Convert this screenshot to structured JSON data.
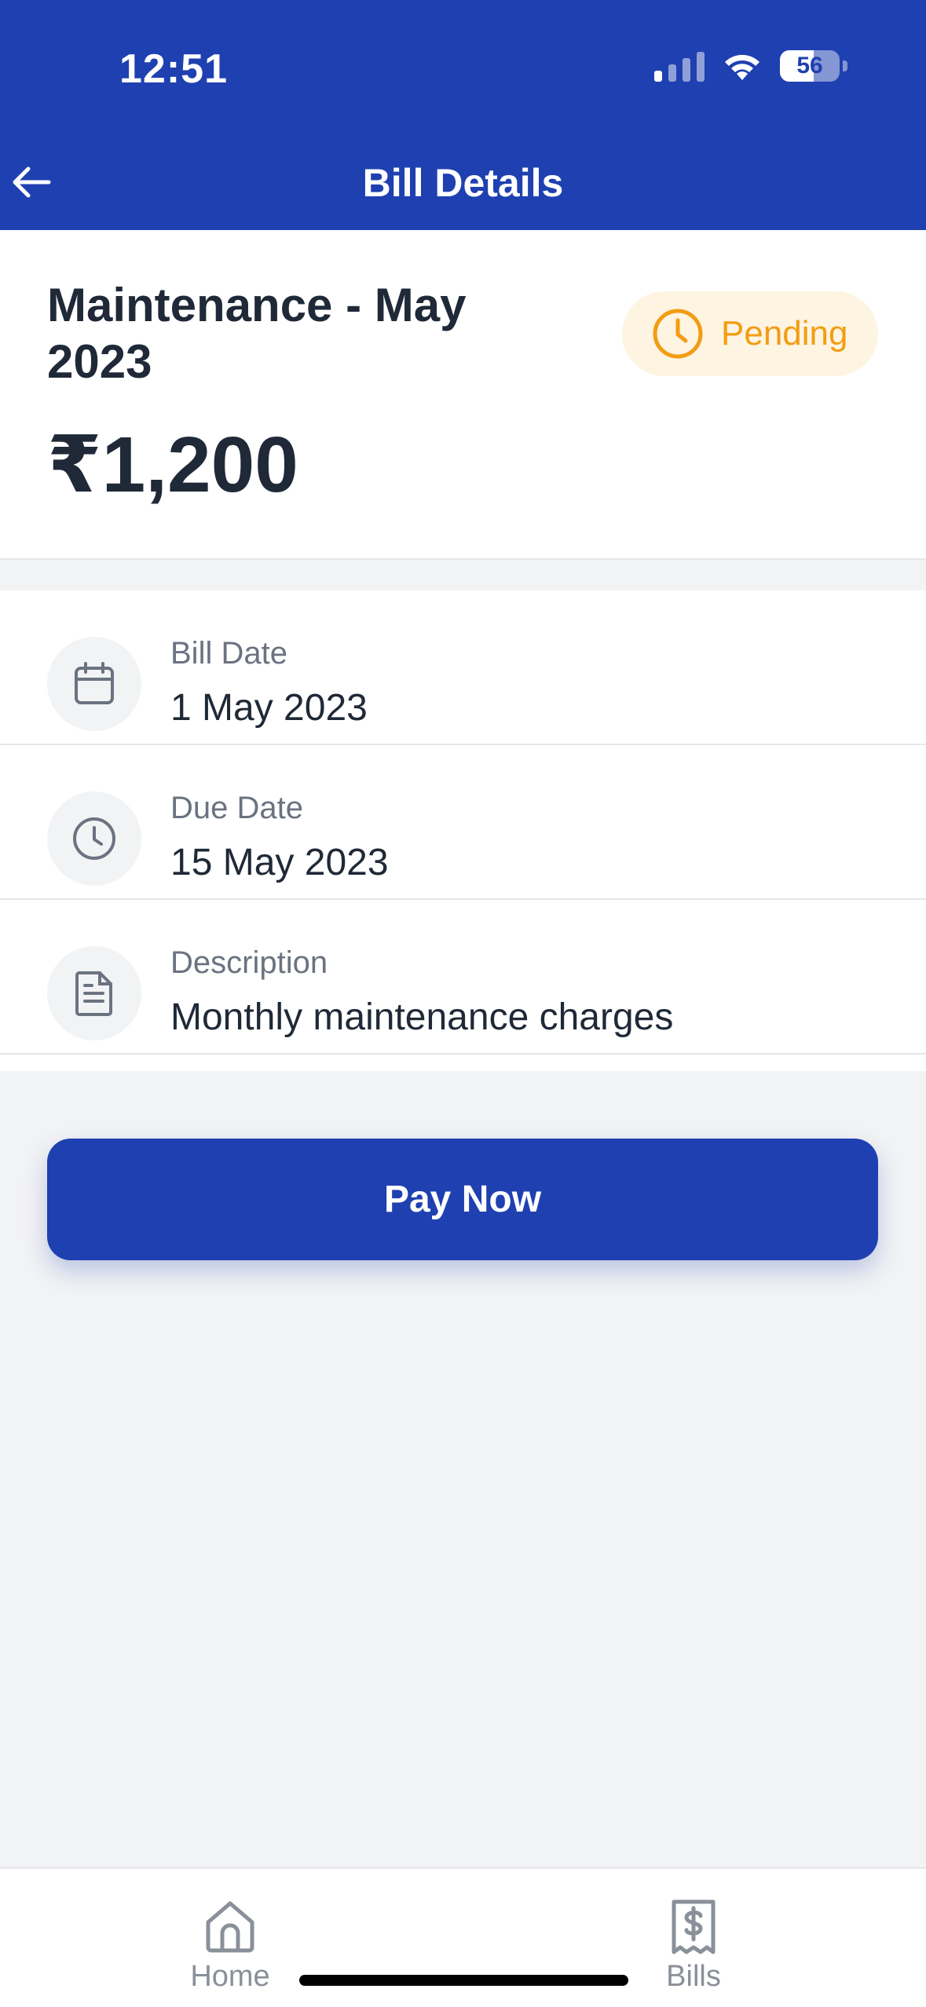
{
  "status_bar": {
    "time": "12:51",
    "battery": "56"
  },
  "header": {
    "title": "Bill Details",
    "back_icon": "arrow-left-icon",
    "background_color": "#1f40b0"
  },
  "bill": {
    "title": "Maintenance - May 2023",
    "amount": "₹1,200",
    "status": "Pending",
    "status_color": "#f39c12"
  },
  "details": [
    {
      "icon": "calendar-icon",
      "label": "Bill Date",
      "value": "1 May 2023"
    },
    {
      "icon": "clock-icon",
      "label": "Due Date",
      "value": "15 May 2023"
    },
    {
      "icon": "document-icon",
      "label": "Description",
      "value": "Monthly maintenance charges"
    }
  ],
  "actions": {
    "pay_label": "Pay Now"
  },
  "tabbar": {
    "items": [
      {
        "label": "Home",
        "icon": "home-icon"
      },
      {
        "label": "Bills",
        "icon": "receipt-dollar-icon"
      }
    ]
  }
}
